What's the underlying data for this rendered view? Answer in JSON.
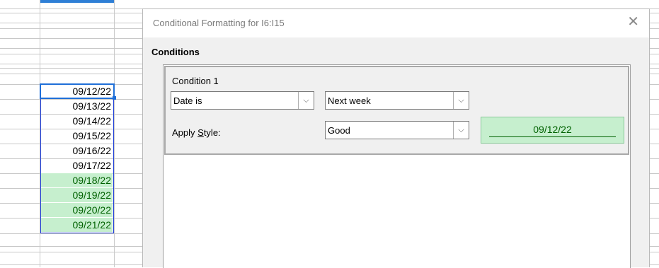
{
  "sheet": {
    "cells": [
      {
        "value": "09/12/22",
        "highlight": false
      },
      {
        "value": "09/13/22",
        "highlight": false
      },
      {
        "value": "09/14/22",
        "highlight": false
      },
      {
        "value": "09/15/22",
        "highlight": false
      },
      {
        "value": "09/16/22",
        "highlight": false
      },
      {
        "value": "09/17/22",
        "highlight": false
      },
      {
        "value": "09/18/22",
        "highlight": true
      },
      {
        "value": "09/19/22",
        "highlight": true
      },
      {
        "value": "09/20/22",
        "highlight": true
      },
      {
        "value": "09/21/22",
        "highlight": true
      }
    ],
    "highlight_color": "#c6efce",
    "highlight_text_color": "#006100",
    "selection_color": "#1f6fd8"
  },
  "dialog": {
    "title": "Conditional Formatting for I6:I15",
    "close_icon": "close-icon",
    "section_label": "Conditions",
    "condition": {
      "label": "Condition 1",
      "type_value": "Date is",
      "date_value": "Next week",
      "apply_style_label_pre": "Apply ",
      "apply_style_label_accel": "S",
      "apply_style_label_post": "tyle:",
      "style_value": "Good",
      "preview_text": "09/12/22"
    }
  }
}
